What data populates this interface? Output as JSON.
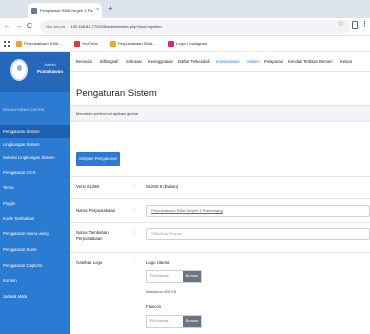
{
  "browser": {
    "tab_title": "Pengaturan SMA Negeri 1 Pa",
    "tab_close": "×",
    "new_tab": "+",
    "nav_back": "←",
    "nav_forward": "→",
    "nav_reload": "C",
    "url_secure": "Not secure",
    "url": "192.168.81.77/2000/admin/index.php?mod=system",
    "star": "☆",
    "kebab": "⋮",
    "bookmarks": [
      {
        "label": "Perpustakaan SMA..."
      },
      {
        "label": "YouTube"
      },
      {
        "label": "Perpustakaan SMA..."
      },
      {
        "label": "Login • Instagram"
      }
    ]
  },
  "sidebar": {
    "role": "Admin",
    "name": "Pustakawan",
    "section": "PENGATURAN SISTEM",
    "items": [
      {
        "label": "Pengaturan Sistem"
      },
      {
        "label": "Lingkungan Sistem"
      },
      {
        "label": "Seleksi Lingkungan Sistem"
      },
      {
        "label": "Pengaturan UCS"
      },
      {
        "label": "Tema"
      },
      {
        "label": "Plugin"
      },
      {
        "label": "Kode Tambahan"
      },
      {
        "label": "Pengaturan menu using"
      },
      {
        "label": "Pengaturan Surel"
      },
      {
        "label": "Pengaturan Captcha"
      },
      {
        "label": "Konten"
      },
      {
        "label": "Jadwal Mata"
      }
    ]
  },
  "topnav": {
    "items": [
      {
        "label": "Beranda",
        "active": false
      },
      {
        "label": "Bibliografi",
        "active": false
      },
      {
        "label": "Sirkulasi",
        "active": false
      },
      {
        "label": "Keanggotaan",
        "active": false
      },
      {
        "label": "Daftar Terkendali",
        "active": false
      },
      {
        "label": "Inventarisasi",
        "active": true
      },
      {
        "label": "Sistem",
        "active": true
      },
      {
        "label": "Pelaporan",
        "active": false
      },
      {
        "label": "Kendali Terbitan Berseri",
        "active": false
      },
      {
        "label": "Keluar",
        "active": false
      }
    ]
  },
  "main": {
    "title": "Pengaturan Sistem",
    "subtitle": "Menubah preferensi aplikasi global",
    "save_button": "Simpan Pengaturan",
    "slims_label": "Versi SLiMS",
    "slims_value": "SLiMS 9 (Bulian)",
    "colon": ":",
    "library_name_label": "Nama Perpustakaan",
    "library_name_value": "Perpustakaan SMA Negeri 1 Palembang",
    "additional_name_label": "Nama Tambahan Perpustakaan",
    "additional_name_placeholder": "SMA/Ada Perpus",
    "logo_label": "Gambar Logo",
    "logo_main_title": "Logo Utama",
    "file_placeholder": "Pilih berkas",
    "browse_label": "Browse",
    "max_size_note": "Maksimum 500 KB",
    "favicon_title": "Favicon",
    "favicon_file_placeholder": "Pilih berkas",
    "favicon_browse_label": "Browse"
  }
}
